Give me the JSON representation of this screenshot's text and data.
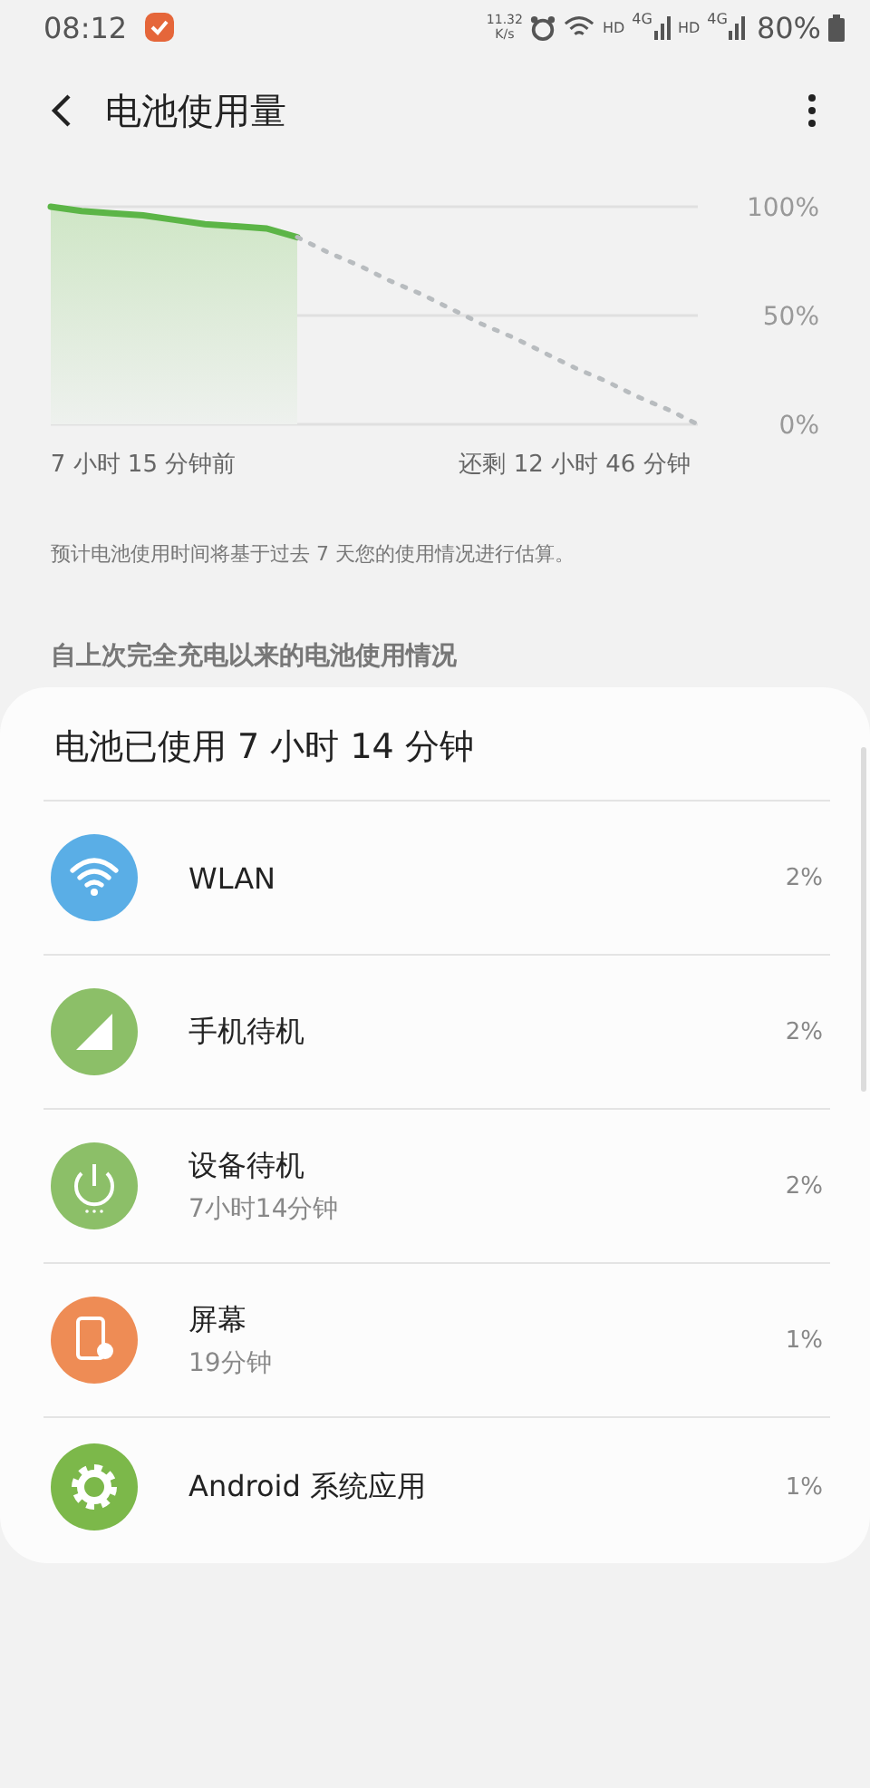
{
  "status_bar": {
    "time": "08:12",
    "speed": "11.32",
    "speed_unit": "K/s",
    "network_1": "HD",
    "network_1_type": "4G",
    "network_2": "HD",
    "network_2_type": "4G",
    "battery": "80%"
  },
  "header": {
    "title": "电池使用量"
  },
  "chart_data": {
    "type": "line",
    "categories": [
      null,
      null,
      null,
      "7 小时 15 分钟前",
      null,
      null,
      null,
      null,
      null,
      null,
      null,
      null,
      null,
      null,
      null,
      null,
      null,
      "还剩 12 小时 46 分钟",
      null,
      null,
      null,
      null
    ],
    "ylim": [
      0,
      100
    ],
    "yticks": [
      {
        "value": 0,
        "label": "0%"
      },
      {
        "value": 50,
        "label": "50%"
      },
      {
        "value": 100,
        "label": "100%"
      }
    ],
    "series": [
      {
        "color": "#5cb547",
        "line_style": "solid",
        "values": [
          100,
          98,
          97,
          96,
          94,
          92,
          91,
          90,
          86,
          null,
          null,
          null,
          null,
          null,
          null,
          null,
          null,
          null,
          null,
          null,
          null,
          null
        ]
      },
      {
        "color": "#b8bcbf",
        "line_style": "dotted",
        "values": [
          null,
          null,
          null,
          null,
          null,
          null,
          null,
          null,
          86,
          79,
          73,
          66,
          60,
          53,
          46,
          40,
          33,
          26,
          20,
          13,
          7,
          0
        ]
      }
    ]
  },
  "note": "预计电池使用时间将基于过去 7 天您的使用情况进行估算。",
  "section_title": "自上次完全充电以来的电池使用情况",
  "card": {
    "title": "电池已使用 7 小时 14 分钟",
    "items": [
      {
        "kind": "wifi",
        "color": "#5aaee6",
        "name": "WLAN",
        "percent": "2%"
      },
      {
        "kind": "signal",
        "color": "#8cbf68",
        "name": "手机待机",
        "percent": "2%"
      },
      {
        "kind": "power",
        "color": "#8cbf68",
        "name": "设备待机",
        "detail": "7小时14分钟",
        "percent": "2%"
      },
      {
        "kind": "screen",
        "color": "#ee8c55",
        "name": "屏幕",
        "detail": "19分钟",
        "percent": "1%"
      },
      {
        "kind": "gear",
        "color": "#7cb84a",
        "name": "Android 系统应用",
        "percent": "1%"
      }
    ]
  }
}
